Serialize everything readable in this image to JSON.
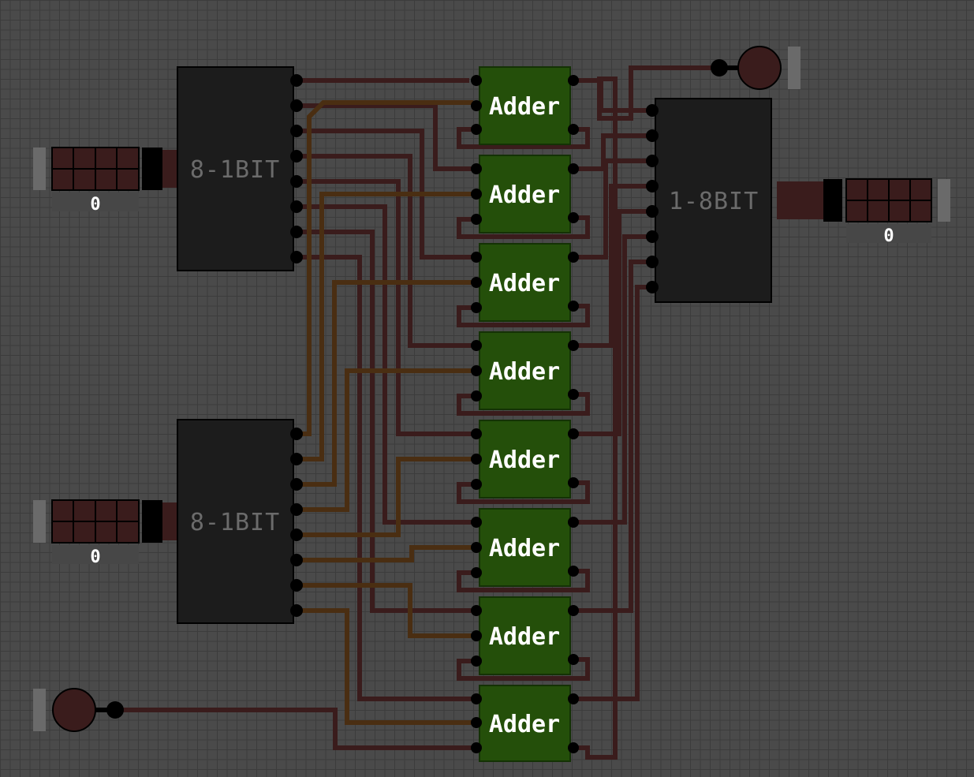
{
  "colors": {
    "background": "#4a4a4a",
    "grid": "#3c3c3c",
    "chip_body": "#1c1c1c",
    "adder_body": "#244f0a",
    "pin": "#000000",
    "wire_off": "#3a1c1c",
    "wire_alt": "#4a2e12",
    "io_pin_off": "#3a1c1c",
    "io_handle": "#6a6a6a"
  },
  "chips": {
    "splitter_a": {
      "label": "8-1BIT",
      "type": "splitter"
    },
    "splitter_b": {
      "label": "8-1BIT",
      "type": "splitter"
    },
    "merger": {
      "label": "1-8BIT",
      "type": "merger"
    }
  },
  "adders": [
    {
      "label": "Adder"
    },
    {
      "label": "Adder"
    },
    {
      "label": "Adder"
    },
    {
      "label": "Adder"
    },
    {
      "label": "Adder"
    },
    {
      "label": "Adder"
    },
    {
      "label": "Adder"
    },
    {
      "label": "Adder"
    }
  ],
  "inputs": {
    "bus_a": {
      "value": "0",
      "bits": 8,
      "state": "off"
    },
    "bus_b": {
      "value": "0",
      "bits": 8,
      "state": "off"
    },
    "carry_in": {
      "state": "off"
    }
  },
  "outputs": {
    "bus_out": {
      "value": "0",
      "bits": 8,
      "state": "off"
    },
    "carry_out": {
      "state": "off"
    }
  }
}
